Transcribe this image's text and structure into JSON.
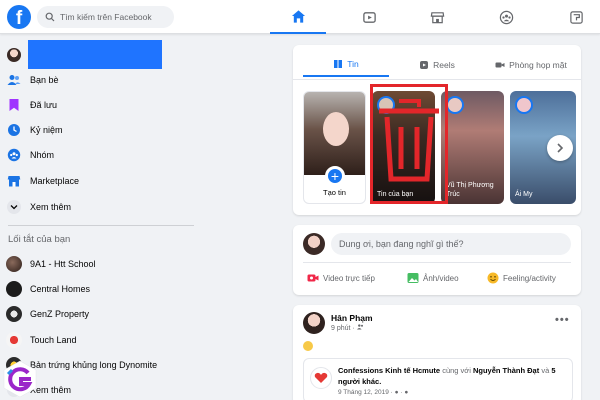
{
  "header": {
    "logo_letter": "f",
    "search": {
      "placeholder": "Tìm kiếm trên Facebook"
    },
    "tabs": [
      {
        "icon": "home-icon",
        "active": true
      },
      {
        "icon": "watch-icon",
        "active": false
      },
      {
        "icon": "marketplace-icon",
        "active": false
      },
      {
        "icon": "groups-icon",
        "active": false
      },
      {
        "icon": "gaming-icon",
        "active": false
      }
    ]
  },
  "sidebar": {
    "items": [
      {
        "label": "Bạn bè",
        "icon": "friends-icon"
      },
      {
        "label": "Đã lưu",
        "icon": "saved-icon"
      },
      {
        "label": "Kỷ niệm",
        "icon": "memories-icon"
      },
      {
        "label": "Nhóm",
        "icon": "groups-icon"
      },
      {
        "label": "Marketplace",
        "icon": "marketplace-icon"
      },
      {
        "label": "Xem thêm",
        "icon": "chevron-down-icon"
      }
    ],
    "shortcuts_heading": "Lối tắt của bạn",
    "shortcuts": [
      {
        "label": "9A1 - Htt School"
      },
      {
        "label": "Central Homes"
      },
      {
        "label": "GenZ Property"
      },
      {
        "label": "Touch Land"
      },
      {
        "label": "Bản trứng khủng long Dynomite"
      },
      {
        "label": "Xem thêm"
      }
    ]
  },
  "stories": {
    "tabs": [
      {
        "label": "Tin",
        "icon": "book-icon",
        "active": true
      },
      {
        "label": "Reels",
        "icon": "reels-icon",
        "active": false
      },
      {
        "label": "Phòng họp mặt",
        "icon": "video-camera-icon",
        "active": false
      }
    ],
    "create_label": "Tạo tin",
    "items": [
      {
        "name": "Tin của bạn"
      },
      {
        "name": "Vũ Thị Phương Trúc"
      },
      {
        "name": "Ái My"
      }
    ]
  },
  "composer": {
    "placeholder": "Dung ơi, bạn đang nghĩ gì thế?",
    "actions": [
      {
        "label": "Video trực tiếp",
        "icon": "live-video-icon",
        "color": "#f02849"
      },
      {
        "label": "Ảnh/video",
        "icon": "photo-icon",
        "color": "#45bd62"
      },
      {
        "label": "Feeling/activity",
        "icon": "feeling-icon",
        "color": "#f7b928"
      }
    ]
  },
  "post": {
    "author": "Hân Phạm",
    "time": "9 phút ·",
    "shared": {
      "page": "Confessions Kinh tế Hcmute",
      "connector": " cùng với ",
      "tagged": "Nguyễn Thành Đạt",
      "and": " và ",
      "others": "5 người khác.",
      "date": "9 Tháng 12, 2019 · ● · ●"
    }
  },
  "colors": {
    "brand": "#1877f2",
    "highlight_box": "#e3262a",
    "page_bg": "#f0f2f5"
  }
}
